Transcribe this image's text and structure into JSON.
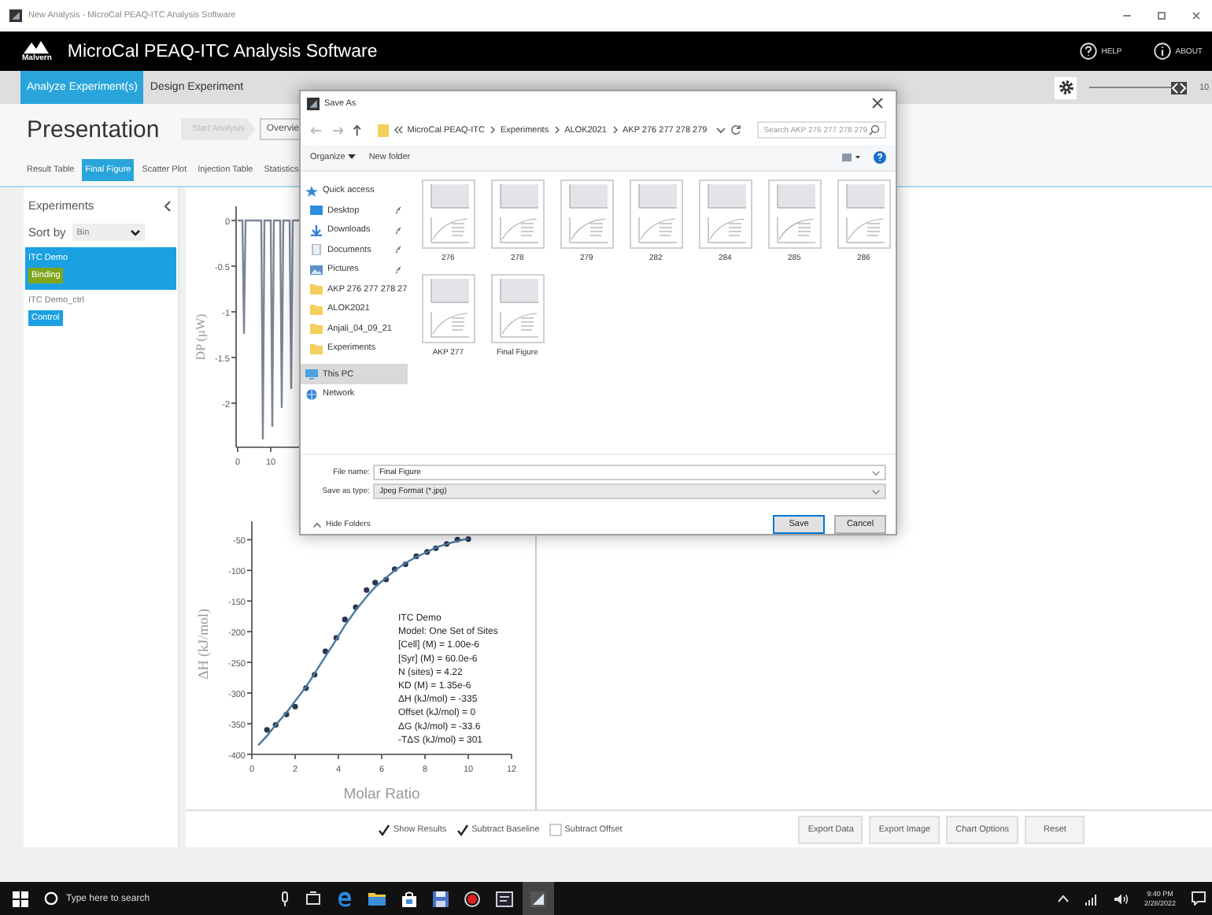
{
  "window": {
    "title": "New Analysis - MicroCal PEAQ-ITC Analysis Software"
  },
  "header": {
    "logo": "Malvern",
    "title": "MicroCal PEAQ-ITC Analysis Software",
    "links": [
      {
        "kind": "help",
        "label": "HELP"
      },
      {
        "kind": "about",
        "label": "ABOUT"
      }
    ]
  },
  "main_tabs": [
    {
      "label": "Analyze Experiment(s)",
      "selected": true
    },
    {
      "label": "Design Experiment",
      "selected": false
    }
  ],
  "zoom_slider": {
    "level": 0.92,
    "reading": "10"
  },
  "presentation": {
    "title": "Presentation",
    "start_button": {
      "label": "Start Analysis",
      "disabled": true
    },
    "overview_button": {
      "label": "Overvie"
    }
  },
  "view_tabs": [
    {
      "label": "Result Table",
      "selected": false
    },
    {
      "label": "Final Figure",
      "selected": true
    },
    {
      "label": "Scatter Plot",
      "selected": false
    },
    {
      "label": "Injection Table",
      "selected": false
    },
    {
      "label": "Statistics",
      "selected": false
    }
  ],
  "experiments": {
    "title": "Experiments",
    "sort_label": "Sort by",
    "sort_value": "Bin",
    "items": [
      {
        "name": "ITC Demo",
        "tag": "Binding",
        "color": "#7fa61b",
        "selected": true
      },
      {
        "name": "ITC Demo_ctrl",
        "tag": "Control",
        "color": "#1ba1e2",
        "selected": false
      }
    ]
  },
  "thermogram": {
    "ylabel": "DP (µW)",
    "yticks": [
      "0",
      "-0.5",
      "-1",
      "-1.5",
      "-2"
    ],
    "xticks": [
      "0",
      "10"
    ]
  },
  "binding_plot": {
    "chart_data": {
      "type": "scatter",
      "xlabel": "Molar Ratio",
      "ylabel": "ΔH (kJ/mol)",
      "x": [
        0.3,
        0.7,
        1.1,
        1.6,
        2.0,
        2.5,
        2.9,
        3.4,
        3.9,
        4.3,
        4.8,
        5.3,
        5.7,
        6.2,
        6.6,
        7.1,
        7.6,
        8.1,
        8.5,
        9.0,
        9.5,
        10.0
      ],
      "series": [
        {
          "color": "#2b3550",
          "values": [
            null,
            -360,
            -352,
            -335,
            -322,
            -292,
            -270,
            -232,
            -210,
            -180,
            -160,
            -132,
            -120,
            -115,
            -98,
            -90,
            -77,
            -70,
            -64,
            -57,
            -50,
            -49
          ]
        },
        {
          "type": "line",
          "color": "#4a7aa0",
          "values": [
            -385,
            -370,
            -352,
            -332,
            -313,
            -290,
            -268,
            -240,
            -213,
            -190,
            -165,
            -143,
            -127,
            -112,
            -100,
            -88,
            -78,
            -70,
            -63,
            -57,
            -52,
            -48
          ]
        }
      ],
      "xlim": [
        0,
        12
      ],
      "ylim": [
        -400,
        -20
      ],
      "xticks": [
        0,
        2,
        4,
        6,
        8,
        10,
        12
      ],
      "yticks": [
        -50,
        -100,
        -150,
        -200,
        -250,
        -300,
        -350,
        -400
      ]
    },
    "legend": [
      "ITC Demo",
      "Model: One Set of Sites",
      "[Cell] (M) = 1.00e-6",
      "[Syr] (M) = 60.0e-6",
      "N (sites) = 4.22",
      "KD (M) = 1.35e-6",
      "ΔH (kJ/mol) = -335",
      "Offset (kJ/mol) = 0",
      "ΔG (kJ/mol) = -33.6",
      "-TΔS (kJ/mol) = 301"
    ]
  },
  "options": [
    {
      "label": "Show Results",
      "checked": true
    },
    {
      "label": "Subtract Baseline",
      "checked": true
    },
    {
      "label": "Subtract Offset",
      "checked": false
    }
  ],
  "actions": [
    "Export Data",
    "Export Image",
    "Chart Options",
    "Reset"
  ],
  "dialog": {
    "title": "Save As",
    "path": [
      "MicroCal PEAQ-ITC",
      "Experiments",
      "ALOK2021",
      "AKP 276 277 278 279"
    ],
    "search_placeholder": "Search AKP 276 277 278 279",
    "toolbar": [
      "Organize",
      "New folder"
    ],
    "nav": [
      {
        "label": "Quick access",
        "kind": "star",
        "pinned": false,
        "selected": false,
        "children": [
          {
            "label": "Desktop",
            "kind": "desktop",
            "pinned": true,
            "selected": false
          },
          {
            "label": "Downloads",
            "kind": "download",
            "pinned": true,
            "selected": false
          },
          {
            "label": "Documents",
            "kind": "document",
            "pinned": true,
            "selected": false
          },
          {
            "label": "Pictures",
            "kind": "pictures",
            "pinned": true,
            "selected": false
          },
          {
            "label": "AKP 276 277 278 27",
            "kind": "folder",
            "pinned": false,
            "selected": false
          },
          {
            "label": "ALOK2021",
            "kind": "folder",
            "pinned": false,
            "selected": false
          },
          {
            "label": "Anjali_04_09_21",
            "kind": "folder",
            "pinned": false,
            "selected": false
          },
          {
            "label": "Experiments",
            "kind": "folder",
            "pinned": false,
            "selected": false
          }
        ]
      },
      {
        "label": "This PC",
        "kind": "pc",
        "pinned": false,
        "selected": true
      },
      {
        "label": "Network",
        "kind": "network",
        "pinned": false,
        "selected": false
      }
    ],
    "files": [
      "276",
      "278",
      "279",
      "282",
      "284",
      "285",
      "286",
      "AKP 277",
      "Final Figure"
    ],
    "file_name_label": "File name:",
    "file_name": "Final Figure",
    "type_label": "Save as type:",
    "type_value": "Jpeg Format (*.jpg)",
    "hide_folders": "Hide Folders",
    "buttons": [
      "Save",
      "Cancel"
    ]
  },
  "taskbar": {
    "search_placeholder": "Type here to search",
    "time": "9:40 PM",
    "date": "2/28/2022"
  }
}
